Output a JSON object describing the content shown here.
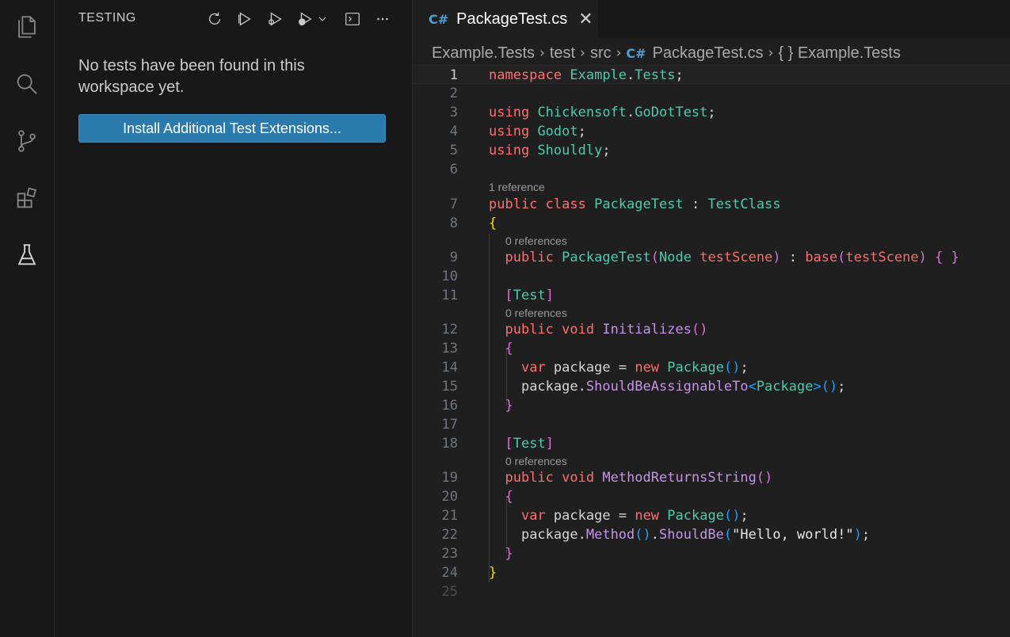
{
  "activity_bar": {
    "icons": [
      "files-icon",
      "search-icon",
      "source-control-icon",
      "extensions-icon",
      "testing-flask-icon"
    ]
  },
  "sidebar": {
    "title": "TESTING",
    "actions": [
      "refresh-icon",
      "run-tests-icon",
      "debug-tests-icon",
      "run-coverage-icon",
      "chevron-down-icon",
      "terminal-icon",
      "more-icon"
    ],
    "empty_message": "No tests have been found in this workspace yet.",
    "install_button": "Install Additional Test Extensions..."
  },
  "editor": {
    "tab": {
      "label": "PackageTest.cs",
      "icon": "C#",
      "close": "✕"
    },
    "breadcrumb": {
      "items": [
        "Example.Tests",
        "test",
        "src",
        "PackageTest.cs",
        "{ } Example.Tests"
      ],
      "separator": "›"
    },
    "code_lens": {
      "class_refs": "1 reference",
      "ctor_refs": "0 references",
      "test1_refs": "0 references",
      "test2_refs": "0 references"
    },
    "line_numbers": [
      "1",
      "2",
      "3",
      "4",
      "5",
      "6",
      "7",
      "8",
      "9",
      "10",
      "11",
      "12",
      "13",
      "14",
      "15",
      "16",
      "17",
      "18",
      "19",
      "20",
      "21",
      "22",
      "23",
      "24",
      "25"
    ],
    "code": {
      "l1_kw": "namespace",
      "l1_ns1": "Example",
      "l1_dot": ".",
      "l1_ns2": "Tests",
      "l1_end": ";",
      "using": "using",
      "l3_ns1": "Chickensoft",
      "l3_ns2": "GoDotTest",
      "l4_ns": "Godot",
      "l5_ns": "Shouldly",
      "public": "public",
      "class": "class",
      "void": "void",
      "var": "var",
      "new": "new",
      "class_name": "PackageTest",
      "colon": ":",
      "base_type": "TestClass",
      "open_brace": "{",
      "close_brace": "}",
      "ctor_name": "PackageTest",
      "param_type": "Node",
      "param_name": "testScene",
      "base_kw": "base",
      "attr": "Test",
      "m1": "Initializes",
      "m2": "MethodReturnsString",
      "local": "package",
      "eq": "=",
      "type_pkg": "Package",
      "call1": "ShouldBeAssignableTo",
      "call2": "Method",
      "call3": "ShouldBe",
      "string": "\"Hello, world!\""
    }
  }
}
